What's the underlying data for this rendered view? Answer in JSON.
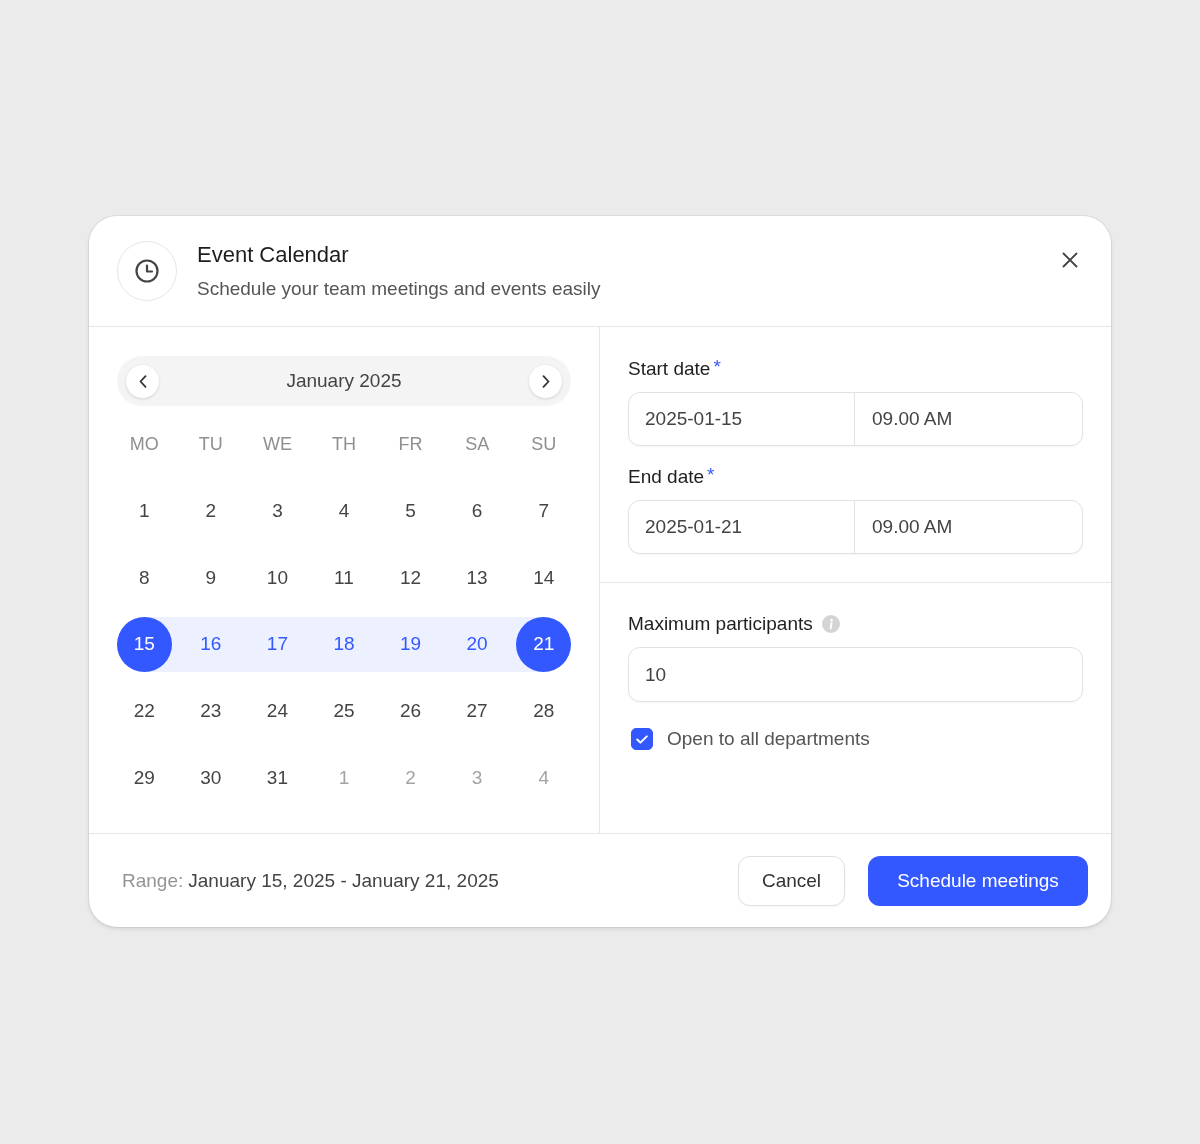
{
  "dialog": {
    "title": "Event Calendar",
    "subtitle": "Schedule your team meetings and events easily"
  },
  "calendar": {
    "month": "January 2025",
    "weekdays": [
      "MO",
      "TU",
      "WE",
      "TH",
      "FR",
      "SA",
      "SU"
    ],
    "weeks": [
      [
        {
          "day": "1",
          "kind": "current",
          "selected": false,
          "in_range": false
        },
        {
          "day": "2",
          "kind": "current",
          "selected": false,
          "in_range": false
        },
        {
          "day": "3",
          "kind": "current",
          "selected": false,
          "in_range": false
        },
        {
          "day": "4",
          "kind": "current",
          "selected": false,
          "in_range": false
        },
        {
          "day": "5",
          "kind": "current",
          "selected": false,
          "in_range": false
        },
        {
          "day": "6",
          "kind": "current",
          "selected": false,
          "in_range": false
        },
        {
          "day": "7",
          "kind": "current",
          "selected": false,
          "in_range": false
        }
      ],
      [
        {
          "day": "8",
          "kind": "current",
          "selected": false,
          "in_range": false
        },
        {
          "day": "9",
          "kind": "current",
          "selected": false,
          "in_range": false
        },
        {
          "day": "10",
          "kind": "current",
          "selected": false,
          "in_range": false
        },
        {
          "day": "11",
          "kind": "current",
          "selected": false,
          "in_range": false
        },
        {
          "day": "12",
          "kind": "current",
          "selected": false,
          "in_range": false
        },
        {
          "day": "13",
          "kind": "current",
          "selected": false,
          "in_range": false
        },
        {
          "day": "14",
          "kind": "current",
          "selected": false,
          "in_range": false
        }
      ],
      [
        {
          "day": "15",
          "kind": "current",
          "selected": true,
          "in_range": true
        },
        {
          "day": "16",
          "kind": "current",
          "selected": false,
          "in_range": true
        },
        {
          "day": "17",
          "kind": "current",
          "selected": false,
          "in_range": true
        },
        {
          "day": "18",
          "kind": "current",
          "selected": false,
          "in_range": true
        },
        {
          "day": "19",
          "kind": "current",
          "selected": false,
          "in_range": true
        },
        {
          "day": "20",
          "kind": "current",
          "selected": false,
          "in_range": true
        },
        {
          "day": "21",
          "kind": "current",
          "selected": true,
          "in_range": true
        }
      ],
      [
        {
          "day": "22",
          "kind": "current",
          "selected": false,
          "in_range": false
        },
        {
          "day": "23",
          "kind": "current",
          "selected": false,
          "in_range": false
        },
        {
          "day": "24",
          "kind": "current",
          "selected": false,
          "in_range": false
        },
        {
          "day": "25",
          "kind": "current",
          "selected": false,
          "in_range": false
        },
        {
          "day": "26",
          "kind": "current",
          "selected": false,
          "in_range": false
        },
        {
          "day": "27",
          "kind": "current",
          "selected": false,
          "in_range": false
        },
        {
          "day": "28",
          "kind": "current",
          "selected": false,
          "in_range": false
        }
      ],
      [
        {
          "day": "29",
          "kind": "current",
          "selected": false,
          "in_range": false
        },
        {
          "day": "30",
          "kind": "current",
          "selected": false,
          "in_range": false
        },
        {
          "day": "31",
          "kind": "current",
          "selected": false,
          "in_range": false
        },
        {
          "day": "1",
          "kind": "adjacent",
          "selected": false,
          "in_range": false
        },
        {
          "day": "2",
          "kind": "adjacent",
          "selected": false,
          "in_range": false
        },
        {
          "day": "3",
          "kind": "adjacent",
          "selected": false,
          "in_range": false
        },
        {
          "day": "4",
          "kind": "adjacent",
          "selected": false,
          "in_range": false
        }
      ]
    ]
  },
  "schedule": {
    "fields": [
      {
        "label": "Start date",
        "required_mark": "*",
        "date": "2025-01-15",
        "time": "09.00 AM"
      },
      {
        "label": "End date",
        "required_mark": "*",
        "date": "2025-01-21",
        "time": "09.00 AM"
      }
    ]
  },
  "participants": {
    "label": "Maximum participants",
    "value": "10"
  },
  "option": {
    "label": "Open to all departments",
    "checked": true
  },
  "footer": {
    "range_label": "Range:",
    "range_value": "January 15, 2025 - January 21, 2025",
    "buttons": [
      {
        "label": "Cancel",
        "kind": "secondary"
      },
      {
        "label": "Schedule meetings",
        "kind": "primary"
      }
    ]
  }
}
